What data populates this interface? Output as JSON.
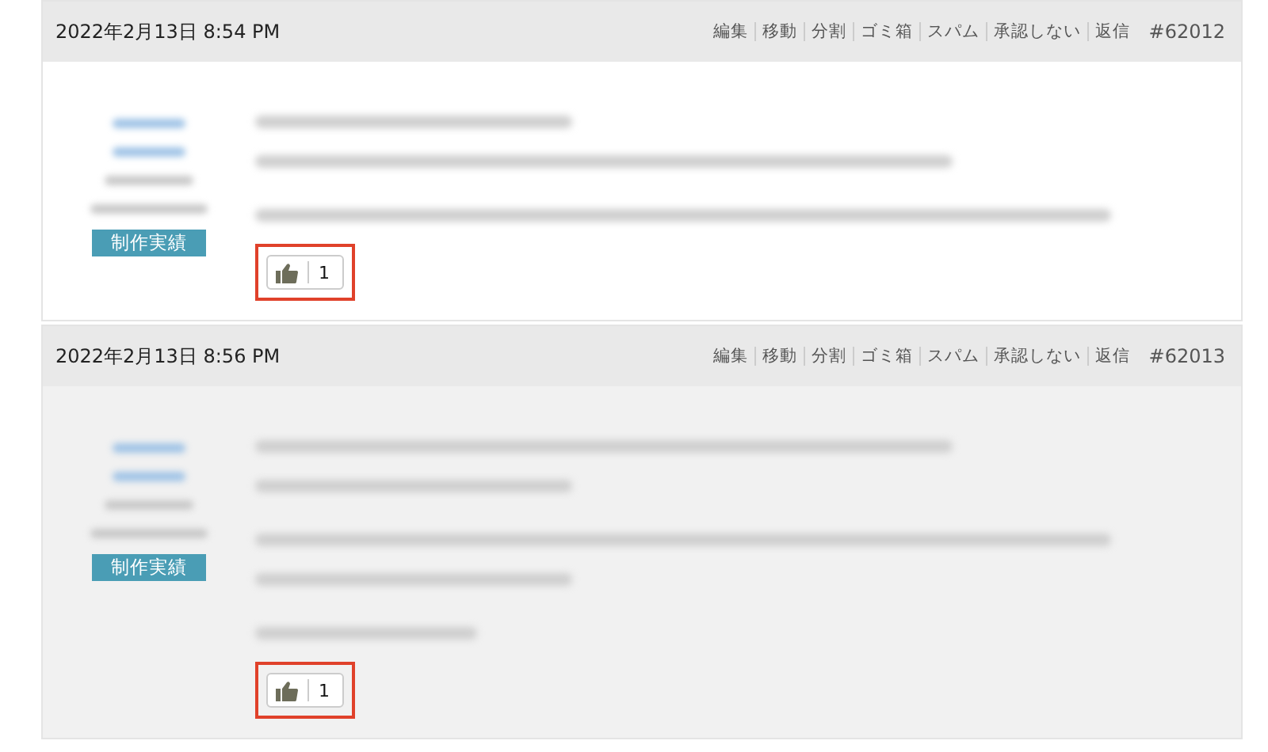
{
  "comments": [
    {
      "date": "2022年2月13日 8:54 PM",
      "actions": [
        "編集",
        "移動",
        "分割",
        "ゴミ箱",
        "スパム",
        "承認しない",
        "返信"
      ],
      "number": "#62012",
      "shaded": false,
      "badge": "制作実績",
      "author_lines": [
        {
          "kind": "link"
        },
        {
          "kind": "link"
        },
        {
          "kind": "plain"
        },
        {
          "kind": "plain"
        }
      ],
      "paragraphs": [
        {
          "lines": [
            {
              "kind": "short"
            },
            {
              "kind": "long"
            }
          ]
        },
        {
          "lines": [
            {
              "kind": "full"
            }
          ]
        }
      ],
      "like": {
        "count": "1",
        "highlighted": true
      }
    },
    {
      "date": "2022年2月13日 8:56 PM",
      "actions": [
        "編集",
        "移動",
        "分割",
        "ゴミ箱",
        "スパム",
        "承認しない",
        "返信"
      ],
      "number": "#62013",
      "shaded": true,
      "badge": "制作実績",
      "author_lines": [
        {
          "kind": "link"
        },
        {
          "kind": "link"
        },
        {
          "kind": "plain"
        },
        {
          "kind": "plain"
        }
      ],
      "paragraphs": [
        {
          "lines": [
            {
              "kind": "long"
            },
            {
              "kind": "short"
            }
          ]
        },
        {
          "lines": [
            {
              "kind": "full"
            },
            {
              "kind": "short"
            }
          ]
        },
        {
          "lines": [
            {
              "kind": "tiny"
            }
          ]
        }
      ],
      "like": {
        "count": "1",
        "highlighted": true
      }
    }
  ]
}
